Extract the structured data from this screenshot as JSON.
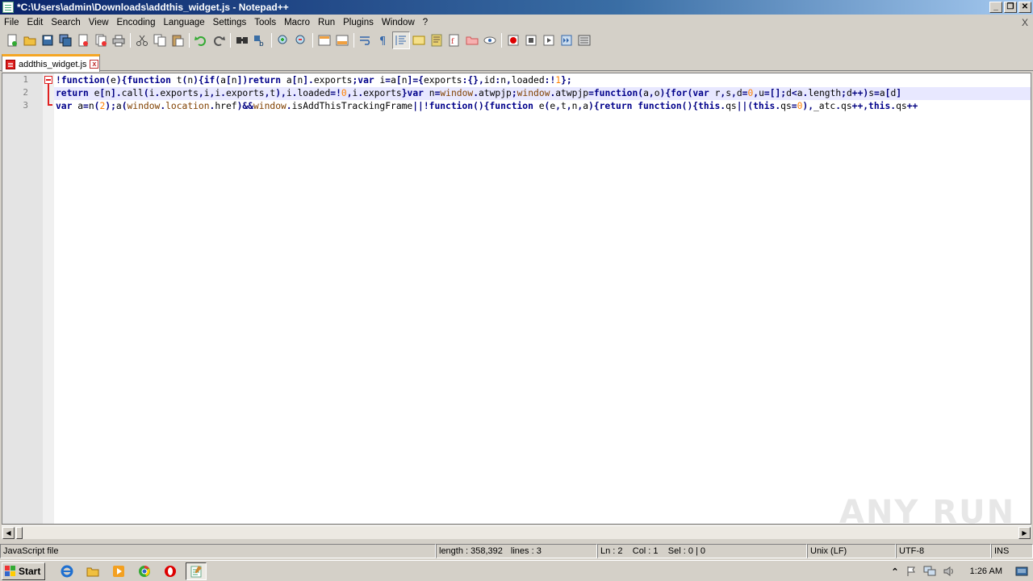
{
  "window": {
    "title": "*C:\\Users\\admin\\Downloads\\addthis_widget.js - Notepad++",
    "controls": [
      "_",
      "❐",
      "✕"
    ]
  },
  "menu": {
    "items": [
      "File",
      "Edit",
      "Search",
      "View",
      "Encoding",
      "Language",
      "Settings",
      "Tools",
      "Macro",
      "Run",
      "Plugins",
      "Window",
      "?"
    ],
    "close_glyph": "X"
  },
  "toolbar": {
    "buttons": [
      "new-file-icon",
      "open-file-icon",
      "save-icon",
      "save-all-icon",
      "close-icon",
      "close-all-icon",
      "print-icon",
      "cut-icon",
      "copy-icon",
      "paste-icon",
      "undo-icon",
      "redo-icon",
      "find-icon",
      "replace-icon",
      "zoom-in-icon",
      "zoom-out-icon",
      "sync-vertical-icon",
      "sync-horizontal-icon",
      "word-wrap-icon",
      "show-all-chars-icon",
      "indent-guide-icon",
      "user-language-icon",
      "doc-map-icon",
      "function-list-icon",
      "folder-workspace-icon",
      "monitoring-icon",
      "record-macro-icon",
      "stop-record-icon",
      "play-macro-icon",
      "run-macro-multiple-icon",
      "save-macro-icon"
    ]
  },
  "tab": {
    "label": "addthis_widget.js",
    "close_glyph": "x"
  },
  "editor": {
    "line_numbers": [
      "1",
      "2",
      "3"
    ],
    "current_line": 2
  },
  "statusbar": {
    "file_type": "JavaScript file",
    "length": "length : 358,392",
    "lines": "lines : 3",
    "position": "Ln : 2    Col : 1    Sel : 0 | 0",
    "eol": "Unix (LF)",
    "encoding": "UTF-8",
    "mode": "INS"
  },
  "taskbar": {
    "start_label": "Start",
    "clock": "1:26 AM"
  },
  "watermark": "ANY RUN",
  "colors": {
    "keyword": "#00008b",
    "window_object": "#804000",
    "number": "#ff8000",
    "current_line": "#e8e8ff",
    "tab_accent": "#f5a623"
  }
}
